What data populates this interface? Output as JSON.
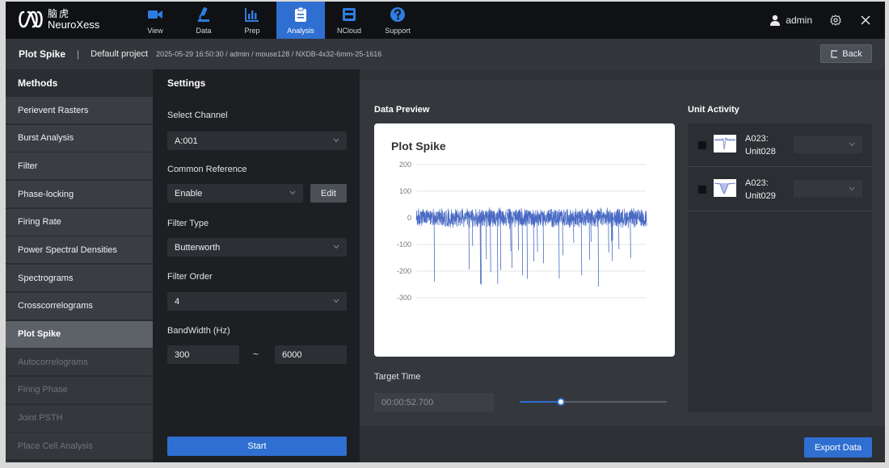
{
  "app": {
    "logo_cn": "脑虎",
    "logo_en": "NeuroXess"
  },
  "nav": [
    {
      "label": "View",
      "icon": "video-camera-icon",
      "active": false
    },
    {
      "label": "Data",
      "icon": "microscope-icon",
      "active": false
    },
    {
      "label": "Prep",
      "icon": "bar-chart-icon",
      "active": false
    },
    {
      "label": "Analysis",
      "icon": "clipboard-icon",
      "active": true
    },
    {
      "label": "NCloud",
      "icon": "cloud-save-icon",
      "active": false
    },
    {
      "label": "Support",
      "icon": "help-icon",
      "active": false
    }
  ],
  "user": {
    "name": "admin"
  },
  "breadcrumb": {
    "title": "Plot Spike",
    "separator": "|",
    "project": "Default project",
    "path": "2025-05-29 16:50:30 / admin / mouse128 / NXDB-4x32-6mm-25-1616",
    "back_label": "Back"
  },
  "methods": {
    "heading": "Methods",
    "items": [
      {
        "label": "Perievent Rasters",
        "state": "normal"
      },
      {
        "label": "Burst Analysis",
        "state": "normal"
      },
      {
        "label": "Filter",
        "state": "normal"
      },
      {
        "label": "Phase-locking",
        "state": "normal"
      },
      {
        "label": "Firing Rate",
        "state": "normal"
      },
      {
        "label": "Power Spectral Densities",
        "state": "normal"
      },
      {
        "label": "Spectrograms",
        "state": "normal"
      },
      {
        "label": "Crosscorrelograms",
        "state": "normal"
      },
      {
        "label": "Plot Spike",
        "state": "active"
      },
      {
        "label": "Autocorrelograms",
        "state": "disabled"
      },
      {
        "label": "Firing Phase",
        "state": "disabled"
      },
      {
        "label": "Joint PSTH",
        "state": "disabled"
      },
      {
        "label": "Place Cell Analysis",
        "state": "disabled"
      }
    ]
  },
  "settings": {
    "heading": "Settings",
    "channel_label": "Select Channel",
    "channel_value": "A:001",
    "reference_label": "Common Reference",
    "reference_value": "Enable",
    "edit_label": "Edit",
    "filter_type_label": "Filter Type",
    "filter_type_value": "Butterworth",
    "filter_order_label": "Filter Order",
    "filter_order_value": "4",
    "bandwidth_label": "BandWidth (Hz)",
    "bandwidth_low": "300",
    "bandwidth_sep": "~",
    "bandwidth_high": "6000",
    "start_label": "Start"
  },
  "preview": {
    "heading": "Data Preview",
    "target_time_label": "Target Time",
    "target_time_value": "00:00:52.700",
    "slider_fraction": 0.28,
    "export_label": "Export Data"
  },
  "units": {
    "heading": "Unit Activity",
    "items": [
      {
        "line1": "A023:",
        "line2": "Unit028"
      },
      {
        "line1": "A023:",
        "line2": "Unit029"
      }
    ]
  },
  "colors": {
    "accent": "#2f6fd1",
    "trace": "#4a6bc4"
  },
  "chart_data": {
    "type": "line",
    "title": "Plot Spike",
    "xlabel": "",
    "ylabel": "",
    "ylim": [
      -300,
      200
    ],
    "yticks": [
      "200",
      "100",
      "0",
      "-100",
      "-200",
      "-300"
    ],
    "grid": true,
    "series": [
      {
        "description_of_shape": "dense noise band roughly -40 to 40 with negative spikes",
        "noise_amplitude": 40,
        "spike_min": -260,
        "spike_count": 30
      }
    ]
  }
}
